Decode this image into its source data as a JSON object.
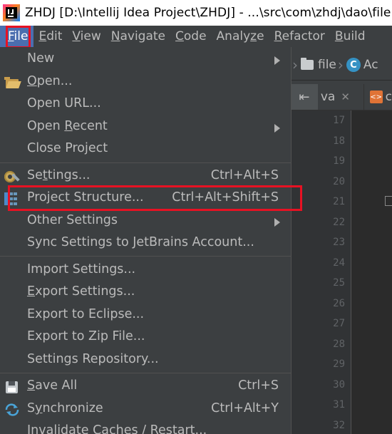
{
  "window": {
    "title": "ZHDJ [D:\\Intellij Idea Project\\ZHDJ] - ...\\src\\com\\zhdj\\dao\\file"
  },
  "menubar": {
    "items": [
      {
        "pre": "",
        "mn": "F",
        "post": "ile"
      },
      {
        "pre": "",
        "mn": "E",
        "post": "dit"
      },
      {
        "pre": "",
        "mn": "V",
        "post": "iew"
      },
      {
        "pre": "",
        "mn": "N",
        "post": "avigate"
      },
      {
        "pre": "",
        "mn": "C",
        "post": "ode"
      },
      {
        "pre": "Analy",
        "mn": "z",
        "post": "e"
      },
      {
        "pre": "",
        "mn": "R",
        "post": "efactor"
      },
      {
        "pre": "",
        "mn": "B",
        "post": "uild"
      }
    ]
  },
  "breadcrumb": {
    "folder": "file",
    "class_badge": "C",
    "class_partial": "Ac"
  },
  "tabs": {
    "first_partial": "va",
    "close_glyph": "✕",
    "second_partial": "c"
  },
  "gutter": {
    "line_numbers": [
      "17",
      "18",
      "19",
      "20",
      "21",
      "22",
      "23",
      "24",
      "25",
      "26",
      "27",
      "28",
      "29",
      "30",
      "31",
      "32"
    ]
  },
  "file_menu": {
    "new": {
      "pre": "",
      "mn": "",
      "post": "New"
    },
    "open": {
      "pre": "",
      "mn": "O",
      "post": "pen..."
    },
    "open_url": {
      "pre": "",
      "mn": "",
      "post": "Open URL..."
    },
    "open_recent": {
      "pre": "Open ",
      "mn": "R",
      "post": "ecent"
    },
    "close_project": {
      "pre": "",
      "mn": "",
      "post": "Close Project"
    },
    "settings": {
      "pre": "Se",
      "mn": "t",
      "post": "tings...",
      "shortcut": "Ctrl+Alt+S"
    },
    "project_structure": {
      "pre": "Project Structure...",
      "mn": "",
      "post": "",
      "shortcut": "Ctrl+Alt+Shift+S"
    },
    "other_settings": {
      "pre": "",
      "mn": "",
      "post": "Other Settings"
    },
    "sync_settings": {
      "pre": "",
      "mn": "",
      "post": "Sync Settings to JetBrains Account..."
    },
    "import_settings": {
      "pre": "",
      "mn": "",
      "post": "Import Settings..."
    },
    "export_settings": {
      "pre": "",
      "mn": "E",
      "post": "xport Settings..."
    },
    "export_eclipse": {
      "pre": "",
      "mn": "",
      "post": "Export to Eclipse..."
    },
    "export_zip": {
      "pre": "",
      "mn": "",
      "post": "Export to Zip File..."
    },
    "settings_repo": {
      "pre": "",
      "mn": "",
      "post": "Settings Repository..."
    },
    "save_all": {
      "pre": "",
      "mn": "S",
      "post": "ave All",
      "shortcut": "Ctrl+S"
    },
    "synchronize": {
      "pre": "S",
      "mn": "y",
      "post": "nchronize",
      "shortcut": "Ctrl+Alt+Y"
    },
    "invalidate": {
      "pre": "",
      "mn": "",
      "post": "Invalidate Caches / Restart..."
    }
  },
  "colors": {
    "menu_bg": "#3c3f41",
    "menu_text": "#bbbbbb",
    "active_menu_bg": "#4b6eaf",
    "annotation_red": "#e81123",
    "editor_bg": "#2b2b2b",
    "gutter_bg": "#313335"
  }
}
